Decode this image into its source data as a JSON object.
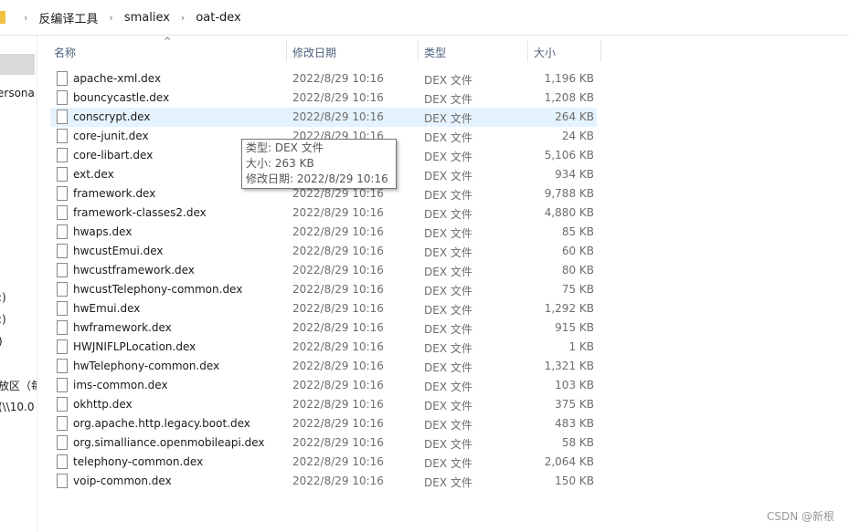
{
  "breadcrumb": [
    "反编译工具",
    "smaliex",
    "oat-dex"
  ],
  "sidebar": {
    "fragments": [
      "ersona",
      ":)",
      ":)",
      ")",
      "放区（每",
      "(\\\\10.0"
    ]
  },
  "columns": {
    "name": "名称",
    "date": "修改日期",
    "type": "类型",
    "size": "大小"
  },
  "files": [
    {
      "name": "apache-xml.dex",
      "date": "2022/8/29 10:16",
      "type": "DEX 文件",
      "size": "1,196 KB"
    },
    {
      "name": "bouncycastle.dex",
      "date": "2022/8/29 10:16",
      "type": "DEX 文件",
      "size": "1,208 KB"
    },
    {
      "name": "conscrypt.dex",
      "date": "2022/8/29 10:16",
      "type": "DEX 文件",
      "size": "264 KB"
    },
    {
      "name": "core-junit.dex",
      "date": "2022/8/29 10:16",
      "type": "DEX 文件",
      "size": "24 KB"
    },
    {
      "name": "core-libart.dex",
      "date": "2022/8/29 10:16",
      "type": "DEX 文件",
      "size": "5,106 KB"
    },
    {
      "name": "ext.dex",
      "date": "2022/8/29 10:16",
      "type": "DEX 文件",
      "size": "934 KB"
    },
    {
      "name": "framework.dex",
      "date": "2022/8/29 10:16",
      "type": "DEX 文件",
      "size": "9,788 KB"
    },
    {
      "name": "framework-classes2.dex",
      "date": "2022/8/29 10:16",
      "type": "DEX 文件",
      "size": "4,880 KB"
    },
    {
      "name": "hwaps.dex",
      "date": "2022/8/29 10:16",
      "type": "DEX 文件",
      "size": "85 KB"
    },
    {
      "name": "hwcustEmui.dex",
      "date": "2022/8/29 10:16",
      "type": "DEX 文件",
      "size": "60 KB"
    },
    {
      "name": "hwcustframework.dex",
      "date": "2022/8/29 10:16",
      "type": "DEX 文件",
      "size": "80 KB"
    },
    {
      "name": "hwcustTelephony-common.dex",
      "date": "2022/8/29 10:16",
      "type": "DEX 文件",
      "size": "75 KB"
    },
    {
      "name": "hwEmui.dex",
      "date": "2022/8/29 10:16",
      "type": "DEX 文件",
      "size": "1,292 KB"
    },
    {
      "name": "hwframework.dex",
      "date": "2022/8/29 10:16",
      "type": "DEX 文件",
      "size": "915 KB"
    },
    {
      "name": "HWJNIFLPLocation.dex",
      "date": "2022/8/29 10:16",
      "type": "DEX 文件",
      "size": "1 KB"
    },
    {
      "name": "hwTelephony-common.dex",
      "date": "2022/8/29 10:16",
      "type": "DEX 文件",
      "size": "1,321 KB"
    },
    {
      "name": "ims-common.dex",
      "date": "2022/8/29 10:16",
      "type": "DEX 文件",
      "size": "103 KB"
    },
    {
      "name": "okhttp.dex",
      "date": "2022/8/29 10:16",
      "type": "DEX 文件",
      "size": "375 KB"
    },
    {
      "name": "org.apache.http.legacy.boot.dex",
      "date": "2022/8/29 10:16",
      "type": "DEX 文件",
      "size": "483 KB"
    },
    {
      "name": "org.simalliance.openmobileapi.dex",
      "date": "2022/8/29 10:16",
      "type": "DEX 文件",
      "size": "58 KB"
    },
    {
      "name": "telephony-common.dex",
      "date": "2022/8/29 10:16",
      "type": "DEX 文件",
      "size": "2,064 KB"
    },
    {
      "name": "voip-common.dex",
      "date": "2022/8/29 10:16",
      "type": "DEX 文件",
      "size": "150 KB"
    }
  ],
  "hovered_index": 2,
  "tooltip": {
    "type": "类型: DEX 文件",
    "size": "大小: 263 KB",
    "date": "修改日期: 2022/8/29 10:16"
  },
  "watermark": "CSDN @新根"
}
